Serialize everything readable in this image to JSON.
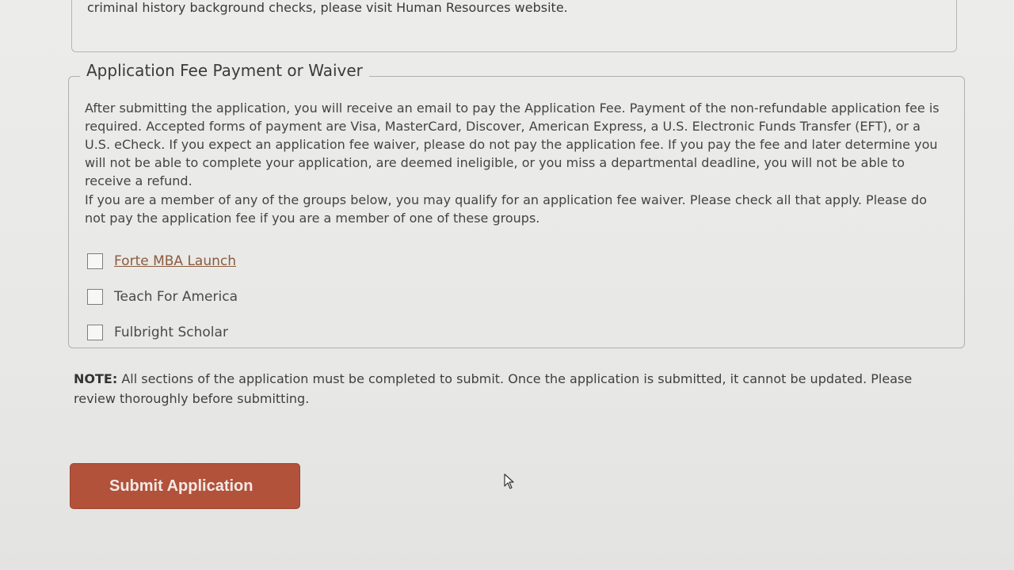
{
  "prev_section": {
    "text": "criminal history background checks, please visit Human Resources website."
  },
  "fee_section": {
    "legend": "Application Fee Payment or Waiver",
    "paragraph1": "After submitting the application, you will receive an email to pay the Application Fee. Payment of the non-refundable application fee is required. Accepted forms of payment are Visa, MasterCard, Discover, American Express, a U.S. Electronic Funds Transfer (EFT), or a U.S. eCheck. If you expect an application fee waiver, please do not pay the application fee. If you pay the fee and later determine you will not be able to complete your application, are deemed ineligible, or you miss a departmental deadline, you will not be able to receive a refund.",
    "paragraph2": "If you are a member of any of the groups below, you may qualify for an application fee waiver. Please check all that apply. Please do not pay the application fee if you are a member of one of these groups.",
    "options": [
      {
        "label": "Forte MBA Launch",
        "checked": false
      },
      {
        "label": "Teach For America",
        "checked": false
      },
      {
        "label": "Fulbright Scholar",
        "checked": false
      }
    ]
  },
  "note": {
    "label": "NOTE:",
    "text": " All sections of the application must be completed to submit. Once the application is submitted, it cannot be updated. Please review thoroughly before submitting."
  },
  "submit": {
    "label": "Submit Application"
  },
  "colors": {
    "submit_bg": "#b2523a",
    "link": "#8a5b3e"
  }
}
